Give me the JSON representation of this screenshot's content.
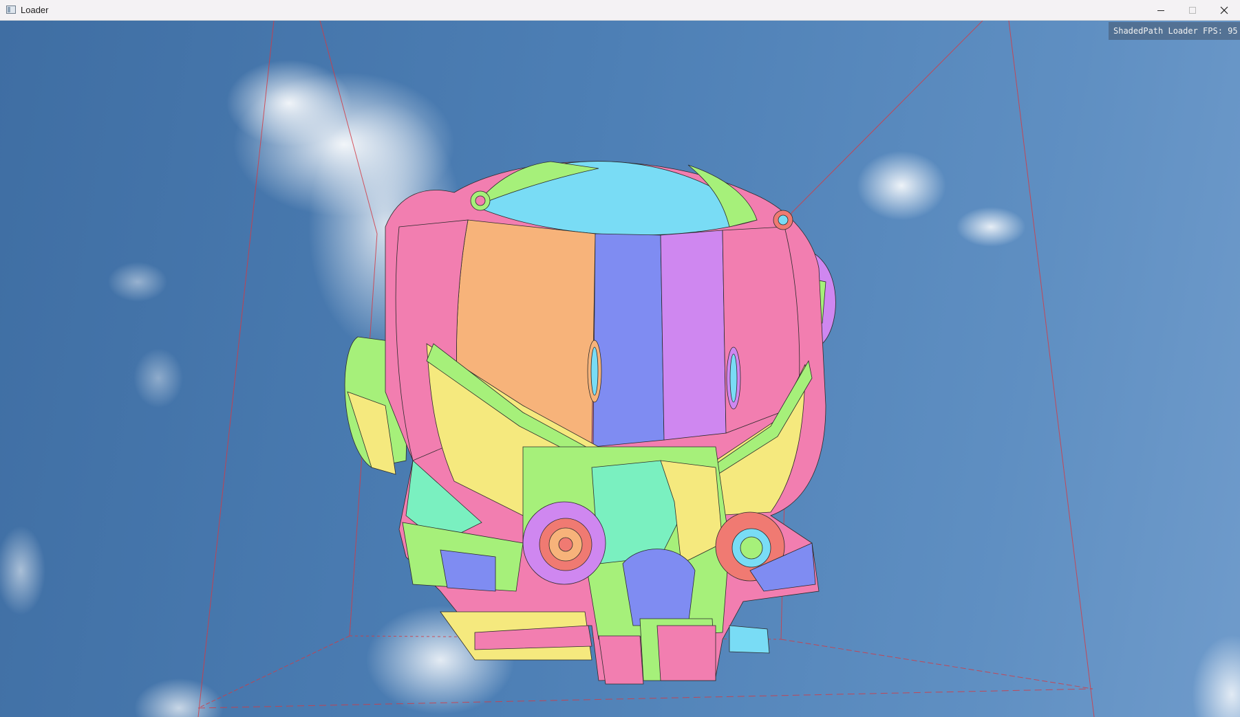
{
  "window": {
    "title": "Loader",
    "icon": "app-window-icon",
    "controls": [
      "minimize-icon",
      "maximize-icon",
      "close-icon"
    ]
  },
  "overlay": {
    "fps_text": "ShadedPath Loader FPS: 95"
  },
  "scene": {
    "model": "helmet",
    "background": "sky-with-clouds",
    "bounding_box_color": "#d23b45",
    "patch_colors": [
      "#f7b37a",
      "#7f8cf2",
      "#cf87f0",
      "#f27eb0",
      "#79dcf5",
      "#a6f07a",
      "#f5e97e",
      "#f07a72",
      "#7af0c0"
    ]
  }
}
